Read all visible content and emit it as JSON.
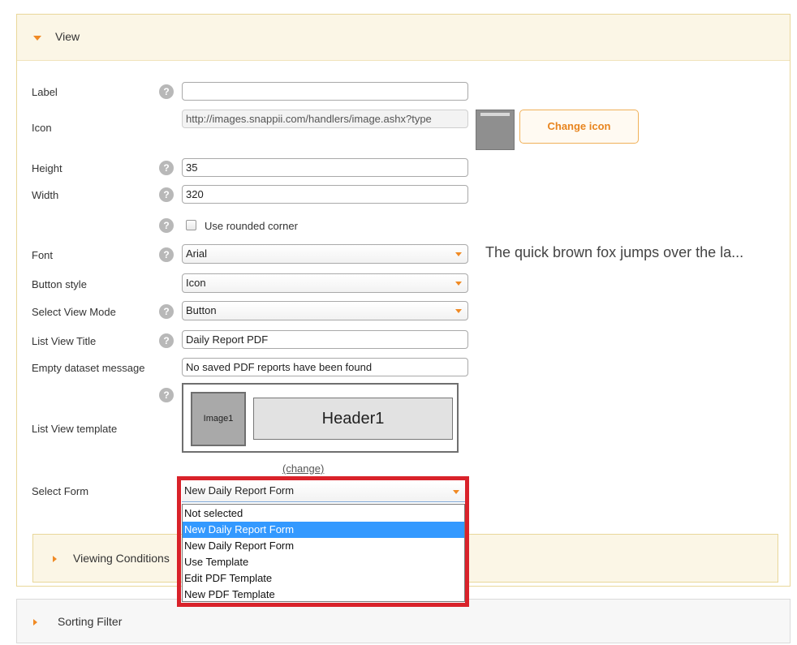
{
  "view_section": {
    "title": "View",
    "label": {
      "label": "Label",
      "value": ""
    },
    "icon": {
      "label": "Icon",
      "value": "http://images.snappii.com/handlers/image.ashx?type",
      "change_button": "Change icon"
    },
    "height": {
      "label": "Height",
      "value": "35"
    },
    "width": {
      "label": "Width",
      "value": "320"
    },
    "rounded_corner": {
      "label": "Use rounded corner",
      "checked": false
    },
    "font": {
      "label": "Font",
      "value": "Arial",
      "preview": "The quick brown fox jumps over the la..."
    },
    "button_style": {
      "label": "Button style",
      "value": "Icon"
    },
    "select_view_mode": {
      "label": "Select View Mode",
      "value": "Button"
    },
    "list_view_title": {
      "label": "List View Title",
      "value": "Daily Report PDF"
    },
    "empty_dataset_message": {
      "label": "Empty dataset message",
      "value": "No saved PDF reports have been found"
    },
    "list_view_template": {
      "label": "List View template",
      "image_text": "Image1",
      "header_text": "Header1",
      "change_link": "(change)"
    },
    "select_form": {
      "label": "Select Form",
      "value": "New Daily Report Form",
      "options": [
        "Not selected",
        "New Daily Report Form",
        "New Daily Report Form",
        "Use Template",
        "Edit PDF Template",
        "New PDF Template"
      ],
      "highlighted_index": 1
    }
  },
  "viewing_conditions": {
    "title": "Viewing Conditions"
  },
  "sorting_filter": {
    "title": "Sorting Filter"
  },
  "help_glyph": "?",
  "colors": {
    "accent": "#f08a24",
    "highlight_border": "#d9222a",
    "selected_option": "#3399ff",
    "panel_bg": "#fbf6e6"
  }
}
